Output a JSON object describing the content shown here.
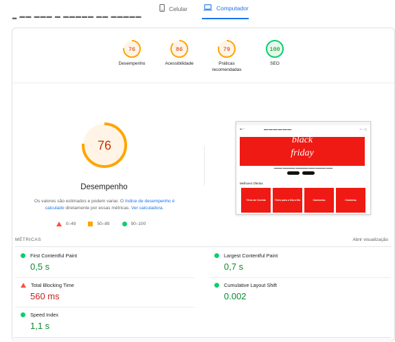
{
  "device_tabs": {
    "mobile_label": "Celular",
    "desktop_label": "Computador",
    "active": "desktop"
  },
  "scores": [
    {
      "label": "Desempenho",
      "value": "76",
      "score": 76,
      "color": "#ffa400",
      "text_color": "#c33300"
    },
    {
      "label": "Acessibilidade",
      "value": "86",
      "score": 86,
      "color": "#ffa400",
      "text_color": "#c33300"
    },
    {
      "label": "Práticas recomendadas",
      "value": "79",
      "score": 79,
      "color": "#ffa400",
      "text_color": "#c33300"
    },
    {
      "label": "SEO",
      "value": "100",
      "score": 100,
      "color": "#0cce6b",
      "text_color": "#008800"
    }
  ],
  "main_gauge": {
    "value": "76",
    "score": 76,
    "title": "Desempenho",
    "color": "#ffa400"
  },
  "note": {
    "part1": "Os valores são estimados e podem variar. O ",
    "link1": "índice de desempenho é calculado",
    "part2": " diretamente por essas métricas. ",
    "link2": "Ver calculadora."
  },
  "legend": [
    {
      "icon": "triangle-icon",
      "label": "0–49"
    },
    {
      "icon": "square-icon",
      "label": "50–89"
    },
    {
      "icon": "circle-icon",
      "label": "90–100"
    }
  ],
  "screenshot": {
    "banner_line1": "black",
    "banner_line2": "friday",
    "offers_title": "Melhores Ofertas",
    "tiles": [
      "Tênis de Corrida",
      "Tênis para o Dia a Dia",
      "Camisetas",
      "Chuteiras"
    ]
  },
  "metrics_header": "MÉTRICAS",
  "metrics_expand": "Abrir visualização",
  "metrics": [
    {
      "name": "First Contentful Paint",
      "value": "0,5 s",
      "status": "pass"
    },
    {
      "name": "Largest Contentful Paint",
      "value": "0,7 s",
      "status": "pass"
    },
    {
      "name": "Total Blocking Time",
      "value": "560 ms",
      "status": "fail"
    },
    {
      "name": "Cumulative Layout Shift",
      "value": "0.002",
      "status": "pass"
    },
    {
      "name": "Speed Index",
      "value": "1,1 s",
      "status": "pass"
    }
  ]
}
